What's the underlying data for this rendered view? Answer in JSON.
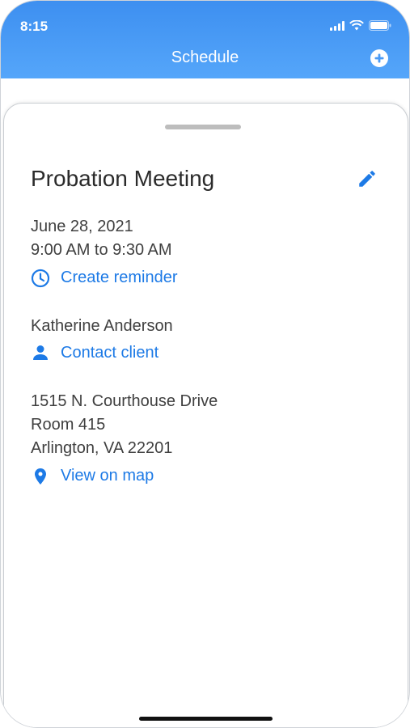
{
  "status": {
    "time": "8:15"
  },
  "header": {
    "title": "Schedule"
  },
  "event": {
    "title": "Probation Meeting",
    "date": "June 28, 2021",
    "time_range": "9:00 AM to 9:30 AM",
    "reminder_link": "Create reminder",
    "client_name": "Katherine Anderson",
    "contact_link": "Contact client",
    "address_line1": "1515 N. Courthouse Drive",
    "address_line2": "Room 415",
    "address_line3": "Arlington, VA 22201",
    "map_link": "View on map"
  },
  "colors": {
    "accent": "#1d7ae6",
    "header": "#4a9af5"
  },
  "icons": [
    "signal-icon",
    "wifi-icon",
    "battery-icon",
    "add-icon",
    "edit-icon",
    "clock-icon",
    "person-icon",
    "map-pin-icon"
  ]
}
